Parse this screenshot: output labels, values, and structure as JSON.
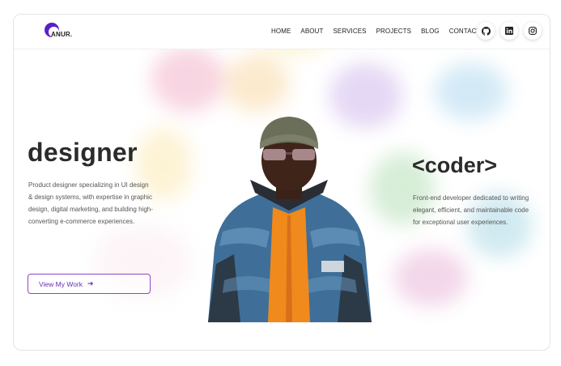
{
  "brand": {
    "logo_text": "ANUR."
  },
  "nav": {
    "items": [
      {
        "label": "HOME"
      },
      {
        "label": "ABOUT"
      },
      {
        "label": "SERVICES"
      },
      {
        "label": "PROJECTS"
      },
      {
        "label": "BLOG"
      },
      {
        "label": "CONTACT"
      }
    ]
  },
  "social": [
    {
      "icon": "github-icon"
    },
    {
      "icon": "linkedin-icon"
    },
    {
      "icon": "instagram-icon"
    }
  ],
  "hero": {
    "left_title": "designer",
    "left_description": "Product designer specializing in UI design & design systems, with expertise in graphic design, digital marketing, and building high-converting e-commerce experiences.",
    "cta_label": "View My Work",
    "cta_icon": "arrow-right-icon",
    "right_title": "<coder>",
    "right_description": "Front-end developer dedicated to writing elegant, efficient, and maintainable code for exceptional user experiences."
  },
  "colors": {
    "accent": "#6a2fb5",
    "logo": "#5b1fc8",
    "text_dark": "#2b2b2b",
    "jacket": "#3f6f98",
    "shirt": "#f08a1c",
    "beanie": "#6b6f5a"
  }
}
